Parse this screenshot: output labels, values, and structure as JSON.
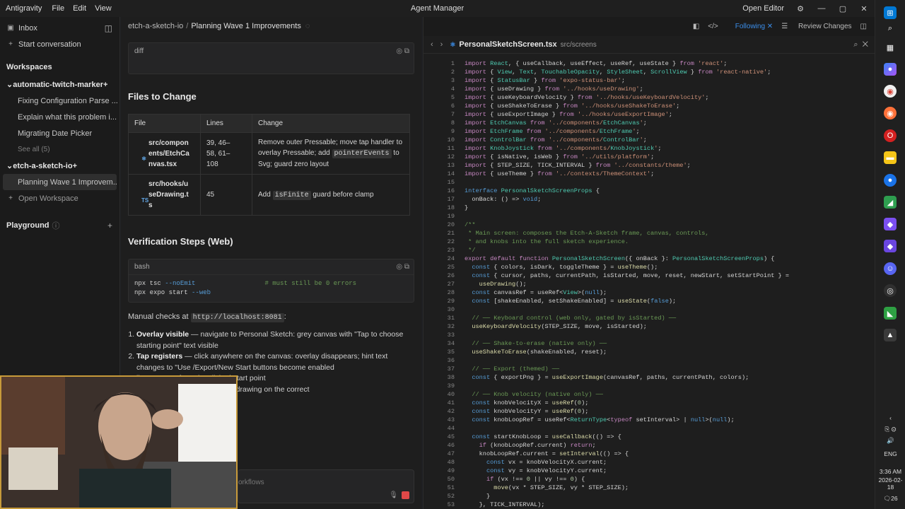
{
  "titlebar": {
    "app_name": "Antigravity",
    "menu": [
      "File",
      "Edit",
      "View"
    ],
    "window_title": "Agent Manager",
    "open_editor": "Open Editor"
  },
  "sidebar": {
    "inbox": "Inbox",
    "start_conversation": "Start conversation",
    "workspaces_heading": "Workspaces",
    "workspaces": [
      {
        "name": "automatic-twitch-marker",
        "items": [
          "Fixing Configuration Parse ...",
          "Explain what this problem i...",
          "Migrating Date Picker"
        ],
        "see_all": "See all (5)"
      },
      {
        "name": "etch-a-sketch-io",
        "items": [
          "Planning Wave 1 Improvem..."
        ]
      }
    ],
    "open_workspace": "Open Workspace",
    "playground": "Playground"
  },
  "chat": {
    "breadcrumb": [
      "etch-a-sketch-io",
      "Planning Wave 1 Improvements"
    ],
    "diff_label": "diff",
    "files_heading": "Files to Change",
    "table_headers": [
      "File",
      "Lines",
      "Change"
    ],
    "rows": [
      {
        "file_lines": [
          "src/compon",
          "ents/EtchCa",
          "nvas.tsx"
        ],
        "lines_lines": [
          "39, 46–",
          "58, 61–",
          "108"
        ],
        "change_pre": "Remove outer Pressable; move tap handler to overlay Pressable; add ",
        "change_code": "pointerEvents",
        "change_post": " to Svg; guard zero layout"
      },
      {
        "file_lines": [
          "src/hooks/u",
          "seDrawing.t",
          "s"
        ],
        "lines_lines": [
          "45"
        ],
        "change_pre": "Add ",
        "change_code": "isFinite",
        "change_post": " guard before clamp"
      }
    ],
    "verification_heading": "Verification Steps (Web)",
    "bash_label": "bash",
    "cmd1_main": "npx tsc ",
    "cmd1_flag": "--noEmit",
    "cmd1_comment": "# must still be 0 errors",
    "cmd2_main": "npx expo start ",
    "cmd2_flag": "--web",
    "manual_checks_pre": "Manual checks at ",
    "manual_checks_url": "http://localhost:8081",
    "manual_checks_post": ":",
    "checks": [
      {
        "bold": "Overlay visible",
        "text": " — navigate to Personal Sketch: grey canvas with \"Tap to choose starting point\" text visible"
      },
      {
        "bold": "Tap registers",
        "text": " — click anywhere on the canvas: overlay disappears; hint text changes to \"Use /Export/New Start buttons become enabled"
      },
      {
        "bold": "",
        "text": "line appears from the clicked start point"
      },
      {
        "bold": "",
        "text": "downloads a .png file with the drawing on the correct"
      }
    ],
    "input_placeholder": "orkflows"
  },
  "editor": {
    "top_actions": [
      "Following",
      "Review Changes"
    ],
    "tab_filename": "PersonalSketchScreen.tsx",
    "tab_dir": "src/screens",
    "code_lines": [
      "import React, { useCallback, useEffect, useRef, useState } from 'react';",
      "import { View, Text, TouchableOpacity, StyleSheet, ScrollView } from 'react-native';",
      "import { StatusBar } from 'expo-status-bar';",
      "import { useDrawing } from '../hooks/useDrawing';",
      "import { useKeyboardVelocity } from '../hooks/useKeyboardVelocity';",
      "import { useShakeToErase } from '../hooks/useShakeToErase';",
      "import { useExportImage } from '../hooks/useExportImage';",
      "import EtchCanvas from '../components/EtchCanvas';",
      "import EtchFrame from '../components/EtchFrame';",
      "import ControlBar from '../components/ControlBar';",
      "import KnobJoystick from '../components/KnobJoystick';",
      "import { isNative, isWeb } from '../utils/platform';",
      "import { STEP_SIZE, TICK_INTERVAL } from '../constants/theme';",
      "import { useTheme } from '../contexts/ThemeContext';",
      "",
      "interface PersonalSketchScreenProps {",
      "  onBack: () => void;",
      "}",
      "",
      "/**",
      " * Main screen: composes the Etch-A-Sketch frame, canvas, controls,",
      " * and knobs into the full sketch experience.",
      " */",
      "export default function PersonalSketchScreen({ onBack }: PersonalSketchScreenProps) {",
      "  const { colors, isDark, toggleTheme } = useTheme();",
      "  const { cursor, paths, currentPath, isStarted, move, reset, newStart, setStartPoint } =",
      "    useDrawing();",
      "  const canvasRef = useRef<View>(null);",
      "  const [shakeEnabled, setShakeEnabled] = useState(false);",
      "",
      "  // ── Keyboard control (web only, gated by isStarted) ──",
      "  useKeyboardVelocity(STEP_SIZE, move, isStarted);",
      "",
      "  // ── Shake-to-erase (native only) ──",
      "  useShakeToErase(shakeEnabled, reset);",
      "",
      "  // ── Export (themed) ──",
      "  const { exportPng } = useExportImage(canvasRef, paths, currentPath, colors);",
      "",
      "  // ── Knob velocity (native only) ──",
      "  const knobVelocityX = useRef(0);",
      "  const knobVelocityY = useRef(0);",
      "  const knobLoopRef = useRef<ReturnType<typeof setInterval> | null>(null);",
      "",
      "  const startKnobLoop = useCallback(() => {",
      "    if (knobLoopRef.current) return;",
      "    knobLoopRef.current = setInterval(() => {",
      "      const vx = knobVelocityX.current;",
      "      const vy = knobVelocityY.current;",
      "      if (vx !== 0 || vy !== 0) {",
      "        move(vx * STEP_SIZE, vy * STEP_SIZE);",
      "      }",
      "    }, TICK_INTERVAL);"
    ]
  },
  "taskbar": {
    "language": "ENG",
    "time": "3:36 AM",
    "date": "2026-02-18",
    "notif_count": "26"
  }
}
